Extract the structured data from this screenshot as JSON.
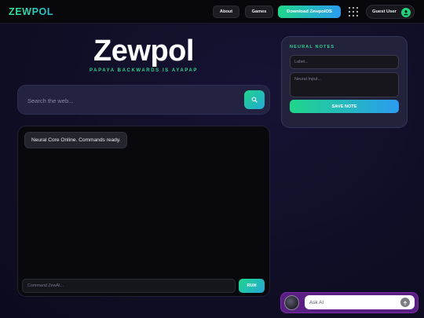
{
  "header": {
    "brand": "ZEWPOL",
    "nav": {
      "about": "About",
      "games": "Games"
    },
    "download_label": "Download ZewpolOS",
    "apps_icon": "grid-dots-icon",
    "user_label": "Guest User",
    "user_icon": "user-icon"
  },
  "hero": {
    "title": "Zewpol",
    "tagline": "PAPAYA BACKWARDS IS AYAPAP"
  },
  "search": {
    "placeholder": "Search the web...",
    "button_icon": "search-icon"
  },
  "chat": {
    "messages": [
      {
        "text": "Neural Core Online. Commands ready."
      }
    ],
    "input_placeholder": "Command ZewAI...",
    "run_label": "RUN"
  },
  "notes": {
    "title": "NEURAL NOTES",
    "label_placeholder": "Label...",
    "input_placeholder": "Neural Input...",
    "save_label": "SAVE NOTE"
  },
  "ask_ai": {
    "placeholder": "Ask AI",
    "send_icon": "arrow-up-icon"
  },
  "colors": {
    "accent_green": "#1fd68a",
    "accent_blue": "#2b9cf0",
    "background": "#100e26",
    "ask_widget": "#5a1f83"
  }
}
